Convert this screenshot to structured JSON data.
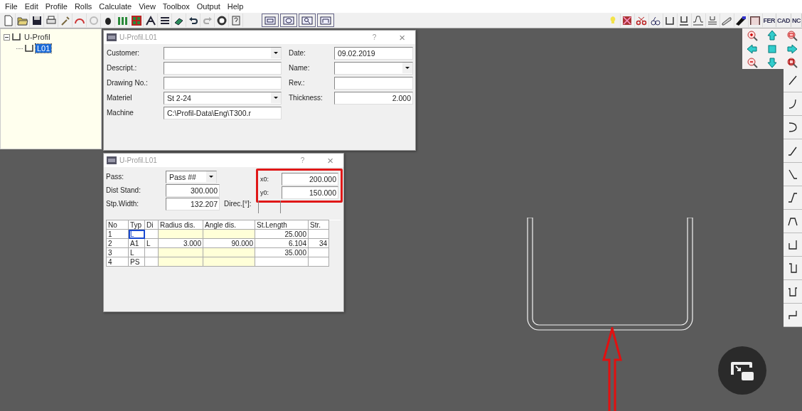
{
  "menu": [
    "File",
    "Edit",
    "Profile",
    "Rolls",
    "Calculate",
    "View",
    "Toolbox",
    "Output",
    "Help"
  ],
  "toolbar_text_buttons": [
    "FER",
    "CAD",
    "NC"
  ],
  "tree": [
    {
      "label": "U-Profil",
      "expanded": true,
      "selected": false,
      "children": [
        {
          "label": "L01",
          "selected": true
        }
      ]
    }
  ],
  "header_dialog": {
    "title": "U-Profil.L01",
    "help": "?",
    "close": "×",
    "fields_left": [
      {
        "label": "Customer:",
        "kind": "combo"
      },
      {
        "label": "Descript.:",
        "kind": "text"
      },
      {
        "label": "Drawing No.:",
        "kind": "text"
      },
      {
        "label": "Materiel",
        "kind": "combo",
        "value": "St 2-24"
      },
      {
        "label": "Machine",
        "kind": "text",
        "value": "C:\\Profil-Data\\Eng\\T300.r"
      }
    ],
    "fields_right": [
      {
        "label": "Date:",
        "kind": "text",
        "value": "09.02.2019"
      },
      {
        "label": "Name:",
        "kind": "combo"
      },
      {
        "label": "Rev.:",
        "kind": "text"
      },
      {
        "label": "Thickness:",
        "kind": "number",
        "value": "2.000"
      }
    ]
  },
  "pass_dialog": {
    "title": "U-Profil.L01",
    "help": "?",
    "close": "×",
    "fields": [
      {
        "label": "Pass:",
        "kind": "combo",
        "value": "Pass ##"
      },
      {
        "label": "Dist Stand:",
        "kind": "number",
        "value": "300.000"
      },
      {
        "label": "Stp.Width:",
        "kind": "number",
        "value": "132.207"
      }
    ],
    "direction": {
      "label": "Direc.[°]:"
    },
    "origin": {
      "highlighted": true,
      "fields": [
        {
          "label": "x0:",
          "value": "200.000"
        },
        {
          "label": "y0:",
          "value": "150.000"
        }
      ]
    },
    "table": {
      "columns": [
        "No",
        "Typ",
        "Di",
        "Radius dis.",
        "Angle dis.",
        "St.Length",
        "Str."
      ],
      "rows": [
        {
          "selected": true,
          "cells": [
            "1",
            "L",
            null,
            null,
            null,
            "25.000",
            null
          ]
        },
        {
          "selected": false,
          "cells": [
            "2",
            "A1",
            "L",
            "3.000",
            "90.000",
            "6.104",
            "34"
          ]
        },
        {
          "selected": false,
          "cells": [
            "3",
            "L",
            null,
            null,
            null,
            "35.000",
            null
          ]
        },
        {
          "selected": false,
          "cells": [
            "4",
            "PS",
            null,
            null,
            null,
            null,
            null
          ]
        }
      ]
    }
  }
}
